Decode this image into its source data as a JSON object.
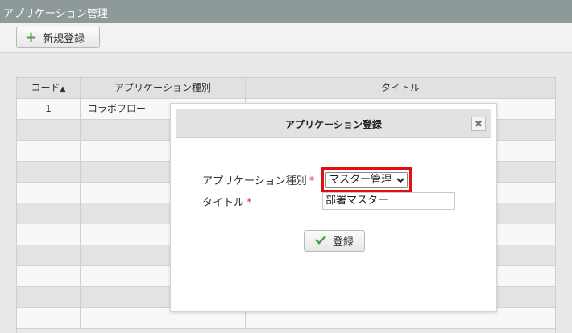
{
  "header": {
    "title": "アプリケーション管理"
  },
  "toolbar": {
    "new_label": "新規登録",
    "new_icon": "plus-icon"
  },
  "grid": {
    "columns": [
      "コード",
      "アプリケーション種別",
      "タイトル"
    ],
    "sort_indicator": "▲",
    "rows": [
      {
        "code": "1",
        "type": "コラボフロー",
        "title": ""
      }
    ]
  },
  "dialog": {
    "title": "アプリケーション登録",
    "close_glyph": "✖",
    "type_label": "アプリケーション種別",
    "title_label": "タイトル",
    "required_mark": "*",
    "type_value": "マスター管理",
    "title_value": "部署マスター",
    "submit_label": "登録"
  },
  "colors": {
    "header_bg": "#8e9a9a",
    "required": "#d9332b",
    "highlight": "#e01010",
    "icon_green": "#4fa04f"
  }
}
